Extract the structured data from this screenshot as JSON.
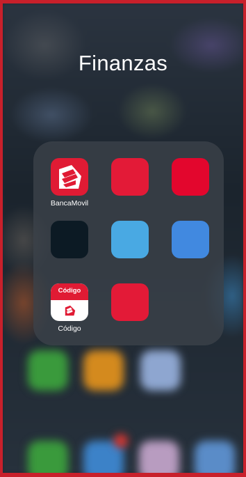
{
  "folder": {
    "title": "Finanzas",
    "apps": [
      {
        "label": "BancaMovil",
        "icon": "bancamovil-logo-icon",
        "color": "#e01b34"
      },
      {
        "label": "",
        "icon": "blank-app-icon",
        "color": "#e31a37"
      },
      {
        "label": "",
        "icon": "blank-app-icon",
        "color": "#e3062d"
      },
      {
        "label": "",
        "icon": "blank-app-icon",
        "color": "#0c1a24"
      },
      {
        "label": "",
        "icon": "blank-app-icon",
        "color": "#49a9e3"
      },
      {
        "label": "",
        "icon": "blank-app-icon",
        "color": "#4189e0"
      },
      {
        "label": "Código",
        "icon": "codigo-logo-icon",
        "color": "#ffffff",
        "badge_text": "Código"
      },
      {
        "label": "",
        "icon": "blank-app-icon",
        "color": "#e31a37"
      }
    ]
  },
  "colors": {
    "border": "#c8202b",
    "brand_red": "#e01b34"
  }
}
